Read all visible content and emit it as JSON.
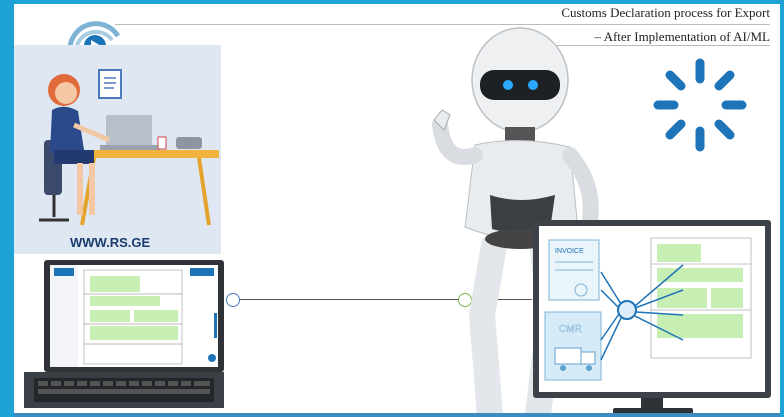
{
  "slide": {
    "title_line1": "Customs Declaration process for Export",
    "title_line2": "– After Implementation of AI/ML",
    "website": "WWW.RS.GE"
  },
  "documents": {
    "invoice_label": "INVOICE",
    "cmr_label": "CMR"
  },
  "colors": {
    "frame_blue": "#1fa3d6",
    "accent_blue": "#1e74b8",
    "highlight_green": "#c7efb4"
  },
  "icons": [
    "company-logo-icon",
    "loading-spinner-icon",
    "robot-icon",
    "laptop-icon",
    "monitor-icon",
    "office-worker-icon"
  ]
}
